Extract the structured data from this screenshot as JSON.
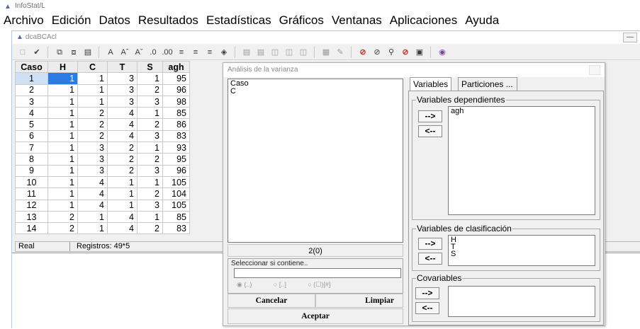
{
  "app": {
    "title": "InfoStat/L"
  },
  "menu": [
    "Archivo",
    "Edición",
    "Datos",
    "Resultados",
    "Estadísticas",
    "Gráficos",
    "Ventanas",
    "Aplicaciones",
    "Ayuda"
  ],
  "child_window": {
    "title": "dcaBCAcl"
  },
  "table": {
    "headers": [
      "Caso",
      "H",
      "C",
      "T",
      "S",
      "agh"
    ],
    "rows": [
      [
        "1",
        "1",
        "1",
        "3",
        "1",
        "95"
      ],
      [
        "2",
        "1",
        "1",
        "3",
        "2",
        "96"
      ],
      [
        "3",
        "1",
        "1",
        "3",
        "3",
        "98"
      ],
      [
        "4",
        "1",
        "2",
        "4",
        "1",
        "85"
      ],
      [
        "5",
        "1",
        "2",
        "4",
        "2",
        "86"
      ],
      [
        "6",
        "1",
        "2",
        "4",
        "3",
        "83"
      ],
      [
        "7",
        "1",
        "3",
        "2",
        "1",
        "93"
      ],
      [
        "8",
        "1",
        "3",
        "2",
        "2",
        "95"
      ],
      [
        "9",
        "1",
        "3",
        "2",
        "3",
        "96"
      ],
      [
        "10",
        "1",
        "4",
        "1",
        "1",
        "105"
      ],
      [
        "11",
        "1",
        "4",
        "1",
        "2",
        "104"
      ],
      [
        "12",
        "1",
        "4",
        "1",
        "3",
        "105"
      ],
      [
        "13",
        "2",
        "1",
        "4",
        "1",
        "85"
      ],
      [
        "14",
        "2",
        "1",
        "4",
        "2",
        "83"
      ]
    ]
  },
  "status": {
    "mode": "Real",
    "records": "Registros: 49*5"
  },
  "dialog": {
    "title": "Análisis de la varianza",
    "source_list": [
      "Caso",
      "C"
    ],
    "source_count": "2(0)",
    "filter": {
      "label": "Seleccionar si contiene..",
      "value": "",
      "options": [
        "(..)",
        "[..]",
        "(☐)[#]"
      ]
    },
    "buttons": {
      "cancel": "Cancelar",
      "clear": "Limpiar",
      "accept": "Aceptar"
    },
    "tabs": [
      "Variables",
      "Particiones ..."
    ],
    "groups": {
      "dependent": {
        "label": "Variables dependientes",
        "items": [
          "agh"
        ]
      },
      "classification": {
        "label": "Variables de clasificación",
        "items": [
          "H",
          "T",
          "S"
        ]
      },
      "covariates": {
        "label": "Covariables",
        "items": []
      }
    },
    "arrows": {
      "add": "-->",
      "remove": "<--"
    }
  }
}
